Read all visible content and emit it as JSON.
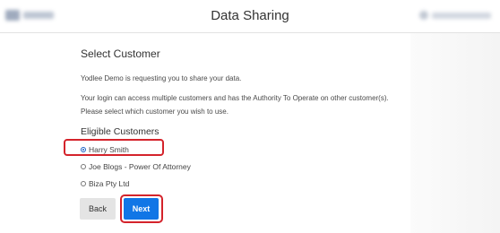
{
  "header": {
    "title": "Data Sharing"
  },
  "main": {
    "section_title": "Select Customer",
    "request_text": "Yodlee Demo is requesting you to share your data.",
    "authority_text": "Your login can access multiple customers and has the Authority To Operate on other customer(s). Please select which customer you wish to use.",
    "eligible_heading": "Eligible Customers",
    "customers": [
      {
        "label": "Harry Smith",
        "selected": true
      },
      {
        "label": "Joe Blogs - Power Of Attorney",
        "selected": false
      },
      {
        "label": "Biza Pty Ltd",
        "selected": false
      }
    ]
  },
  "actions": {
    "back_label": "Back",
    "next_label": "Next"
  },
  "colors": {
    "primary": "#1176e6",
    "highlight": "#d4232b",
    "secondary_button": "#e4e4e4"
  }
}
